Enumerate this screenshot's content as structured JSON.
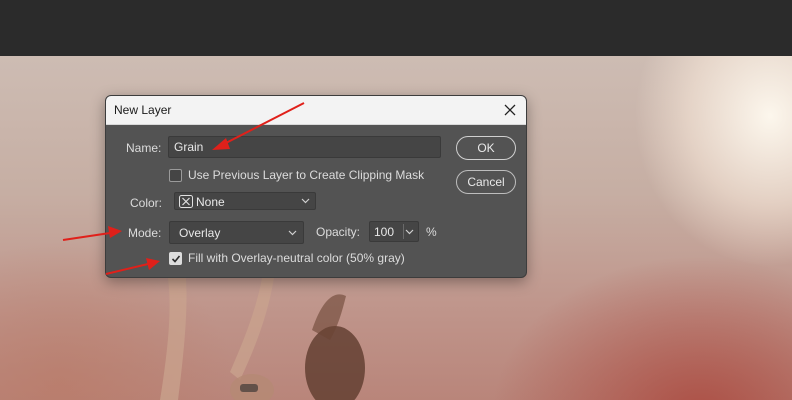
{
  "dialog": {
    "title": "New Layer",
    "name_label": "Name:",
    "name_value": "Grain",
    "clipping_label": "Use Previous Layer to Create Clipping Mask",
    "clipping_checked": false,
    "color_label": "Color:",
    "color_value": "None",
    "mode_label": "Mode:",
    "mode_value": "Overlay",
    "opacity_label": "Opacity:",
    "opacity_value": "100",
    "opacity_unit": "%",
    "fill_label": "Fill with Overlay-neutral color (50% gray)",
    "fill_checked": true,
    "ok_label": "OK",
    "cancel_label": "Cancel"
  },
  "colors": {
    "dialog_bg": "#535353",
    "titlebar_bg": "#f3f3f3",
    "annotation_arrow": "#e0201a"
  },
  "icons": {
    "close": "close-icon",
    "dropdown": "chevron-down-icon",
    "color_swatch_none": "x-box-icon",
    "checkmark": "check-icon"
  }
}
